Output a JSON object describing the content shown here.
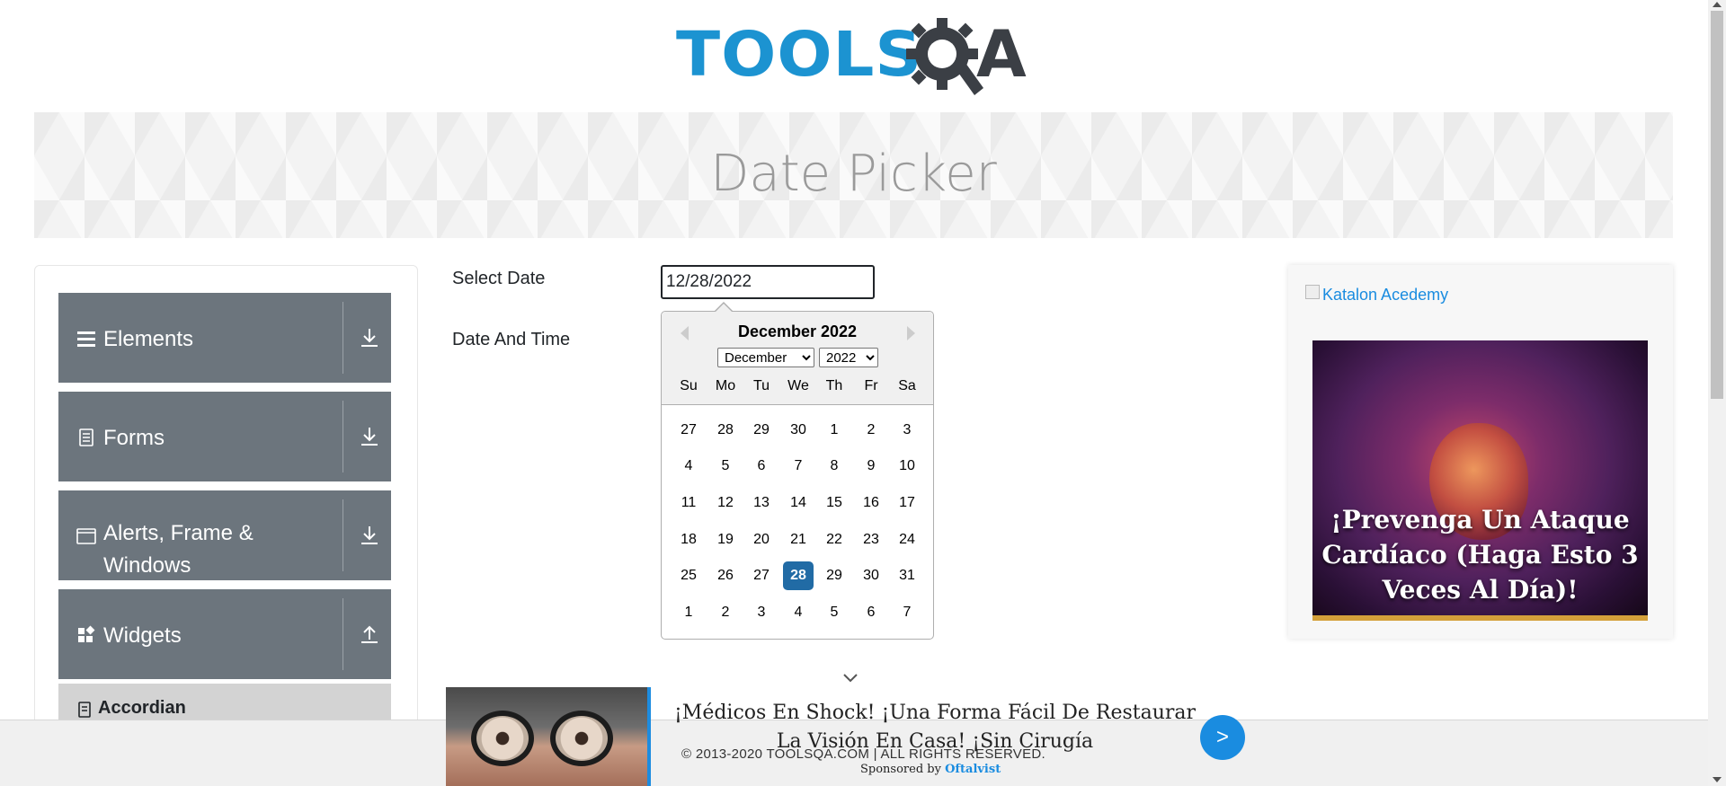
{
  "header": {
    "logo_text_left": "TOOLS",
    "logo_text_right": "A"
  },
  "banner": {
    "title": "Date Picker"
  },
  "sidebar": {
    "groups": [
      {
        "label": "Elements",
        "icon": "hamburger-icon",
        "toggle_icon": "download-arrow-icon"
      },
      {
        "label": "Forms",
        "icon": "document-icon",
        "toggle_icon": "download-arrow-icon"
      },
      {
        "label": "Alerts, Frame & Windows",
        "icon": "window-icon",
        "toggle_icon": "download-arrow-icon"
      },
      {
        "label": "Widgets",
        "icon": "widgets-icon",
        "toggle_icon": "upload-arrow-icon"
      }
    ],
    "sub_items": [
      {
        "label": "Accordian",
        "icon": "document-icon"
      }
    ]
  },
  "form": {
    "select_date_label": "Select Date",
    "select_date_value": "12/28/2022",
    "date_time_label": "Date And Time"
  },
  "datepicker": {
    "title": "December 2022",
    "month_selected": "December",
    "year_selected": "2022",
    "weekdays": [
      "Su",
      "Mo",
      "Tu",
      "We",
      "Th",
      "Fr",
      "Sa"
    ],
    "weeks": [
      [
        "27",
        "28",
        "29",
        "30",
        "1",
        "2",
        "3"
      ],
      [
        "4",
        "5",
        "6",
        "7",
        "8",
        "9",
        "10"
      ],
      [
        "11",
        "12",
        "13",
        "14",
        "15",
        "16",
        "17"
      ],
      [
        "18",
        "19",
        "20",
        "21",
        "22",
        "23",
        "24"
      ],
      [
        "25",
        "26",
        "27",
        "28",
        "29",
        "30",
        "31"
      ],
      [
        "1",
        "2",
        "3",
        "4",
        "5",
        "6",
        "7"
      ]
    ],
    "selected_day": "28",
    "selected_color": "#216ba5"
  },
  "ad_right": {
    "image_alt": "Katalon Acedemy",
    "caption": "¡Prevenga Un Ataque Cardíaco (Haga Esto 3 Veces Al Día)!"
  },
  "bottom_ad": {
    "text": "¡Médicos En Shock! ¡Una Forma Fácil De Restaurar La Visión En Casa! ¡Sin Cirugía",
    "button": ">",
    "sponsored_prefix": "Sponsored by",
    "sponsor": "Oftalvist"
  },
  "footer": {
    "copyright": "© 2013-2020 TOOLSQA.COM | ALL RIGHTS RESERVED."
  },
  "colors": {
    "brand_blue": "#1c93d1",
    "sidebar_group": "#6c757d",
    "link": "#1a8ce0"
  }
}
